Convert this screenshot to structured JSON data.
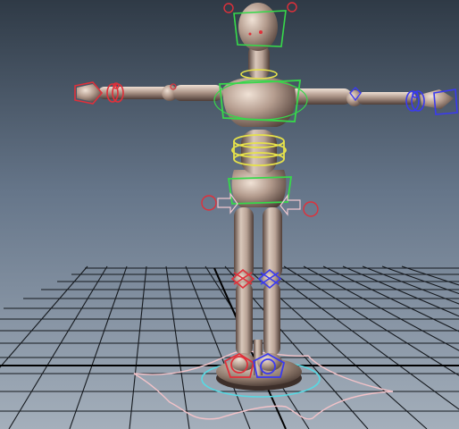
{
  "viewport": {
    "colors": {
      "bg_top": "#374350",
      "bg_mid": "#6b7a89",
      "bg_bottom": "#9aa6b2",
      "grid": "#111418",
      "grid_axis": "#000000",
      "body_light": "#d8c7ba",
      "body_mid": "#9a8578",
      "body_dark": "#4a3a34",
      "control_green": "#39d84a",
      "control_yellow": "#e6e24a",
      "control_red": "#e0303a",
      "control_blue": "#3a3af0",
      "root_cyan": "#53d6e0",
      "root_pink": "#f0b8c0"
    }
  },
  "figure": {
    "name": "wooden-mannequin-rig",
    "pose": "t-pose"
  }
}
